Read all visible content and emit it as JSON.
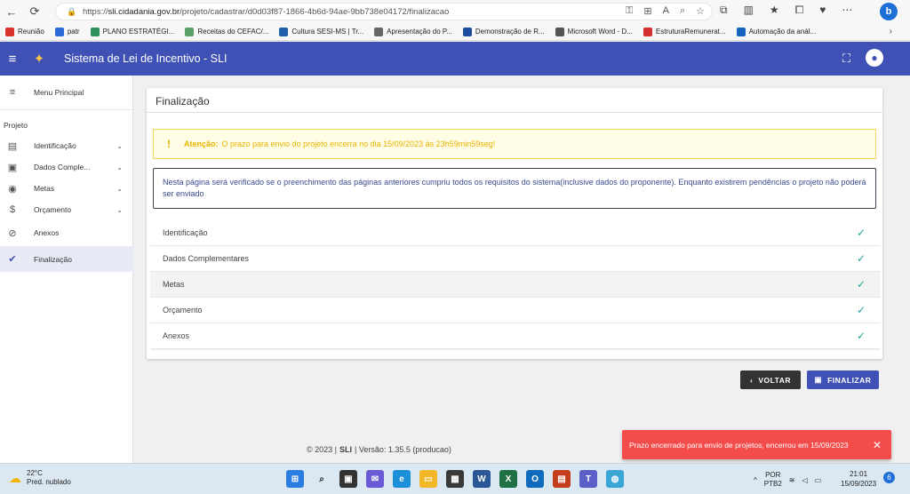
{
  "browser": {
    "url_prefix": "https://",
    "url_domain": "sli.cidadania.gov.br",
    "url_path": "/projeto/cadastrar/d0d03f87-1866-4b6d-94ae-9bb738e04172/finalizacao",
    "bookmarks": [
      {
        "label": "Reunião",
        "color": "#d9342b"
      },
      {
        "label": "patr",
        "color": "#2b6bd9"
      },
      {
        "label": "PLANO ESTRATÉGI...",
        "color": "#2f8f5b"
      },
      {
        "label": "Receitas do CEFAC/...",
        "color": "#5aa06b"
      },
      {
        "label": "Cultura SESI-MS | Tr...",
        "color": "#1f5ea8"
      },
      {
        "label": "Apresentação do P...",
        "color": "#666666"
      },
      {
        "label": "Demonstração de R...",
        "color": "#1d4e9e"
      },
      {
        "label": "Microsoft Word - D...",
        "color": "#555555"
      },
      {
        "label": "EstruturaRemunerat...",
        "color": "#d32f2f"
      },
      {
        "label": "Automação da anál...",
        "color": "#1565c0"
      }
    ]
  },
  "header": {
    "title": "Sistema de Lei de Incentivo - SLI"
  },
  "sidebar": {
    "menu_principal": "Menu Principal",
    "section_label": "Projeto",
    "items": [
      {
        "label": "Identificação"
      },
      {
        "label": "Dados Comple..."
      },
      {
        "label": "Metas"
      },
      {
        "label": "Orçamento"
      },
      {
        "label": "Anexos"
      },
      {
        "label": "Finalização"
      }
    ]
  },
  "main": {
    "title": "Finalização",
    "warning_bold": "Atenção:",
    "warning_text": "O prazo para envio do projeto encerra no dia 15/09/2023 às 23h59min59seg!",
    "info_text": "Nesta página será verificado se o preenchimento das páginas anteriores cumpriu todos os requisitos do sistema(inclusive dados do proponente). Enquanto existirem pendências o projeto não poderá ser enviado",
    "checks": [
      {
        "label": "Identificação"
      },
      {
        "label": "Dados Complementares"
      },
      {
        "label": "Metas"
      },
      {
        "label": "Orçamento"
      },
      {
        "label": "Anexos"
      }
    ],
    "back_label": "VOLTAR",
    "finish_label": "FINALIZAR"
  },
  "footer": {
    "prefix": "© 2023 |",
    "brand": "SLI",
    "suffix": "| Versão: 1.35.5 (producao)"
  },
  "toast": {
    "message": "Prazo encerrado para envio de projetos, encerrou em 15/09/2023"
  },
  "taskbar": {
    "temp": "22°C",
    "weather": "Pred. nublado",
    "lang1": "POR",
    "lang2": "PTB2",
    "time": "21:01",
    "date": "15/09/2023",
    "notifications": "6"
  },
  "colors": {
    "primary": "#3f51b5",
    "warning": "#e8b400",
    "success": "#26a69a",
    "toast": "#f44b4b"
  }
}
